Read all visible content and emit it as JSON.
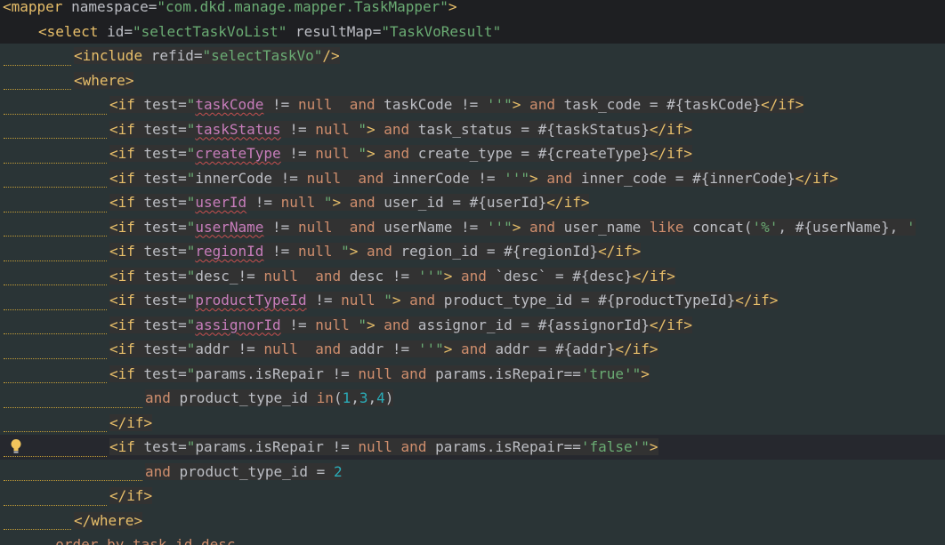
{
  "lines": [
    {
      "indent": 0,
      "type": "xml",
      "tokens": [
        {
          "t": "<",
          "c": "ang"
        },
        {
          "t": "mapper",
          "c": "tag"
        },
        {
          "t": " namespace=",
          "c": "attr"
        },
        {
          "t": "\"com.dkd.manage.mapper.TaskMapper\"",
          "c": "val"
        },
        {
          "t": ">",
          "c": "ang"
        }
      ]
    },
    {
      "indent": 1,
      "type": "xml",
      "tokens": [
        {
          "t": "<",
          "c": "ang"
        },
        {
          "t": "select",
          "c": "tag"
        },
        {
          "t": " id=",
          "c": "attr"
        },
        {
          "t": "\"selectTaskVoList\"",
          "c": "val"
        },
        {
          "t": " resultMap=",
          "c": "attr"
        },
        {
          "t": "\"",
          "c": "val"
        },
        {
          "t": "TaskVoResult",
          "c": "val"
        },
        {
          "t": "\"",
          "c": "val"
        }
      ]
    },
    {
      "indent": 2,
      "type": "sql",
      "tokens": [
        {
          "t": "<",
          "c": "ang"
        },
        {
          "t": "include",
          "c": "tag"
        },
        {
          "t": " refid=",
          "c": "attr"
        },
        {
          "t": "\"selectTaskVo\"",
          "c": "val"
        },
        {
          "t": "/>",
          "c": "ang"
        }
      ]
    },
    {
      "indent": 2,
      "type": "sql",
      "tokens": [
        {
          "t": "<",
          "c": "ang"
        },
        {
          "t": "where",
          "c": "tag"
        },
        {
          "t": ">",
          "c": "ang"
        }
      ]
    },
    {
      "indent": 3,
      "type": "sql",
      "tokens": [
        {
          "t": "<",
          "c": "ang"
        },
        {
          "t": "if",
          "c": "tag"
        },
        {
          "t": " test=",
          "c": "attr"
        },
        {
          "t": "\"",
          "c": "val"
        },
        {
          "t": "taskCode",
          "c": "ident"
        },
        {
          "t": " != ",
          "c": "plain"
        },
        {
          "t": "null",
          "c": "kw"
        },
        {
          "t": "  ",
          "c": "plain"
        },
        {
          "t": "and",
          "c": "kw"
        },
        {
          "t": " taskCode != ",
          "c": "plain"
        },
        {
          "t": "''\"",
          "c": "val"
        },
        {
          "t": ">",
          "c": "ang"
        },
        {
          "t": " and",
          "c": "kw"
        },
        {
          "t": " task_code = #{taskCode}",
          "c": "plain"
        },
        {
          "t": "</",
          "c": "ang"
        },
        {
          "t": "if",
          "c": "tag"
        },
        {
          "t": ">",
          "c": "ang"
        }
      ]
    },
    {
      "indent": 3,
      "type": "sql",
      "tokens": [
        {
          "t": "<",
          "c": "ang"
        },
        {
          "t": "if",
          "c": "tag"
        },
        {
          "t": " test=",
          "c": "attr"
        },
        {
          "t": "\"",
          "c": "val"
        },
        {
          "t": "taskStatus",
          "c": "ident"
        },
        {
          "t": " != ",
          "c": "plain"
        },
        {
          "t": "null",
          "c": "kw"
        },
        {
          "t": " \"",
          "c": "val"
        },
        {
          "t": ">",
          "c": "ang"
        },
        {
          "t": " and",
          "c": "kw"
        },
        {
          "t": " task_status = #{taskStatus}",
          "c": "plain"
        },
        {
          "t": "</",
          "c": "ang"
        },
        {
          "t": "if",
          "c": "tag"
        },
        {
          "t": ">",
          "c": "ang"
        }
      ]
    },
    {
      "indent": 3,
      "type": "sql",
      "tokens": [
        {
          "t": "<",
          "c": "ang"
        },
        {
          "t": "if",
          "c": "tag"
        },
        {
          "t": " test=",
          "c": "attr"
        },
        {
          "t": "\"",
          "c": "val"
        },
        {
          "t": "createType",
          "c": "ident"
        },
        {
          "t": " != ",
          "c": "plain"
        },
        {
          "t": "null",
          "c": "kw"
        },
        {
          "t": " \"",
          "c": "val"
        },
        {
          "t": ">",
          "c": "ang"
        },
        {
          "t": " and",
          "c": "kw"
        },
        {
          "t": " create_type = #{createType}",
          "c": "plain"
        },
        {
          "t": "</",
          "c": "ang"
        },
        {
          "t": "if",
          "c": "tag"
        },
        {
          "t": ">",
          "c": "ang"
        }
      ]
    },
    {
      "indent": 3,
      "type": "sql",
      "tokens": [
        {
          "t": "<",
          "c": "ang"
        },
        {
          "t": "if",
          "c": "tag"
        },
        {
          "t": " test=",
          "c": "attr"
        },
        {
          "t": "\"",
          "c": "val"
        },
        {
          "t": "innerCode != ",
          "c": "plain"
        },
        {
          "t": "null",
          "c": "kw"
        },
        {
          "t": "  ",
          "c": "plain"
        },
        {
          "t": "and",
          "c": "kw"
        },
        {
          "t": " innerCode != ",
          "c": "plain"
        },
        {
          "t": "''\"",
          "c": "val"
        },
        {
          "t": ">",
          "c": "ang"
        },
        {
          "t": " and",
          "c": "kw"
        },
        {
          "t": " inner_code = #{innerCode}",
          "c": "plain"
        },
        {
          "t": "</",
          "c": "ang"
        },
        {
          "t": "if",
          "c": "tag"
        },
        {
          "t": ">",
          "c": "ang"
        }
      ]
    },
    {
      "indent": 3,
      "type": "sql",
      "tokens": [
        {
          "t": "<",
          "c": "ang"
        },
        {
          "t": "if",
          "c": "tag"
        },
        {
          "t": " test=",
          "c": "attr"
        },
        {
          "t": "\"",
          "c": "val"
        },
        {
          "t": "userId",
          "c": "ident"
        },
        {
          "t": " != ",
          "c": "plain"
        },
        {
          "t": "null",
          "c": "kw"
        },
        {
          "t": " \"",
          "c": "val"
        },
        {
          "t": ">",
          "c": "ang"
        },
        {
          "t": " and",
          "c": "kw"
        },
        {
          "t": " user_id = #{userId}",
          "c": "plain"
        },
        {
          "t": "</",
          "c": "ang"
        },
        {
          "t": "if",
          "c": "tag"
        },
        {
          "t": ">",
          "c": "ang"
        }
      ]
    },
    {
      "indent": 3,
      "type": "sql",
      "tokens": [
        {
          "t": "<",
          "c": "ang"
        },
        {
          "t": "if",
          "c": "tag"
        },
        {
          "t": " test=",
          "c": "attr"
        },
        {
          "t": "\"",
          "c": "val"
        },
        {
          "t": "userName",
          "c": "ident"
        },
        {
          "t": " != ",
          "c": "plain"
        },
        {
          "t": "null",
          "c": "kw"
        },
        {
          "t": "  ",
          "c": "plain"
        },
        {
          "t": "and",
          "c": "kw"
        },
        {
          "t": " userName != ",
          "c": "plain"
        },
        {
          "t": "''\"",
          "c": "val"
        },
        {
          "t": ">",
          "c": "ang"
        },
        {
          "t": " and",
          "c": "kw"
        },
        {
          "t": " user_name ",
          "c": "plain"
        },
        {
          "t": "like",
          "c": "kw"
        },
        {
          "t": " concat(",
          "c": "plain"
        },
        {
          "t": "'%'",
          "c": "str"
        },
        {
          "t": ", #{userName}, ",
          "c": "plain"
        },
        {
          "t": "'",
          "c": "str"
        }
      ]
    },
    {
      "indent": 3,
      "type": "sql",
      "tokens": [
        {
          "t": "<",
          "c": "ang"
        },
        {
          "t": "if",
          "c": "tag"
        },
        {
          "t": " test=",
          "c": "attr"
        },
        {
          "t": "\"",
          "c": "val"
        },
        {
          "t": "regionId",
          "c": "ident"
        },
        {
          "t": " != ",
          "c": "plain"
        },
        {
          "t": "null",
          "c": "kw"
        },
        {
          "t": " \"",
          "c": "val"
        },
        {
          "t": ">",
          "c": "ang"
        },
        {
          "t": " and",
          "c": "kw"
        },
        {
          "t": " region_id = #{regionId}",
          "c": "plain"
        },
        {
          "t": "</",
          "c": "ang"
        },
        {
          "t": "if",
          "c": "tag"
        },
        {
          "t": ">",
          "c": "ang"
        }
      ]
    },
    {
      "indent": 3,
      "type": "sql",
      "tokens": [
        {
          "t": "<",
          "c": "ang"
        },
        {
          "t": "if",
          "c": "tag"
        },
        {
          "t": " test=",
          "c": "attr"
        },
        {
          "t": "\"",
          "c": "val"
        },
        {
          "t": "desc_",
          "c": "plain"
        },
        {
          "t": "!= ",
          "c": "plain"
        },
        {
          "t": "null",
          "c": "kw"
        },
        {
          "t": "  ",
          "c": "plain"
        },
        {
          "t": "and",
          "c": "kw"
        },
        {
          "t": " desc != ",
          "c": "plain"
        },
        {
          "t": "''\"",
          "c": "val"
        },
        {
          "t": ">",
          "c": "ang"
        },
        {
          "t": " and",
          "c": "kw"
        },
        {
          "t": " `desc` = #{desc}",
          "c": "plain"
        },
        {
          "t": "</",
          "c": "ang"
        },
        {
          "t": "if",
          "c": "tag"
        },
        {
          "t": ">",
          "c": "ang"
        }
      ]
    },
    {
      "indent": 3,
      "type": "sql",
      "tokens": [
        {
          "t": "<",
          "c": "ang"
        },
        {
          "t": "if",
          "c": "tag"
        },
        {
          "t": " test=",
          "c": "attr"
        },
        {
          "t": "\"",
          "c": "val"
        },
        {
          "t": "productTypeId",
          "c": "ident"
        },
        {
          "t": " != ",
          "c": "plain"
        },
        {
          "t": "null",
          "c": "kw"
        },
        {
          "t": " \"",
          "c": "val"
        },
        {
          "t": ">",
          "c": "ang"
        },
        {
          "t": " and",
          "c": "kw"
        },
        {
          "t": " product_type_id = #{productTypeId}",
          "c": "plain"
        },
        {
          "t": "</",
          "c": "ang"
        },
        {
          "t": "if",
          "c": "tag"
        },
        {
          "t": ">",
          "c": "ang"
        }
      ]
    },
    {
      "indent": 3,
      "type": "sql",
      "tokens": [
        {
          "t": "<",
          "c": "ang"
        },
        {
          "t": "if",
          "c": "tag"
        },
        {
          "t": " test=",
          "c": "attr"
        },
        {
          "t": "\"",
          "c": "val"
        },
        {
          "t": "assignorId",
          "c": "ident"
        },
        {
          "t": " != ",
          "c": "plain"
        },
        {
          "t": "null",
          "c": "kw"
        },
        {
          "t": " \"",
          "c": "val"
        },
        {
          "t": ">",
          "c": "ang"
        },
        {
          "t": " and",
          "c": "kw"
        },
        {
          "t": " assignor_id = #{assignorId}",
          "c": "plain"
        },
        {
          "t": "</",
          "c": "ang"
        },
        {
          "t": "if",
          "c": "tag"
        },
        {
          "t": ">",
          "c": "ang"
        }
      ]
    },
    {
      "indent": 3,
      "type": "sql",
      "tokens": [
        {
          "t": "<",
          "c": "ang"
        },
        {
          "t": "if",
          "c": "tag"
        },
        {
          "t": " test=",
          "c": "attr"
        },
        {
          "t": "\"",
          "c": "val"
        },
        {
          "t": "addr != ",
          "c": "plain"
        },
        {
          "t": "null",
          "c": "kw"
        },
        {
          "t": "  ",
          "c": "plain"
        },
        {
          "t": "and",
          "c": "kw"
        },
        {
          "t": " addr != ",
          "c": "plain"
        },
        {
          "t": "''\"",
          "c": "val"
        },
        {
          "t": ">",
          "c": "ang"
        },
        {
          "t": " and",
          "c": "kw"
        },
        {
          "t": " addr = #{addr}",
          "c": "plain"
        },
        {
          "t": "</",
          "c": "ang"
        },
        {
          "t": "if",
          "c": "tag"
        },
        {
          "t": ">",
          "c": "ang"
        }
      ]
    },
    {
      "indent": 3,
      "type": "sql",
      "tokens": [
        {
          "t": "<",
          "c": "ang"
        },
        {
          "t": "if",
          "c": "tag"
        },
        {
          "t": " test=",
          "c": "attr"
        },
        {
          "t": "\"",
          "c": "val"
        },
        {
          "t": "params.isRepair != ",
          "c": "plain"
        },
        {
          "t": "null",
          "c": "kw"
        },
        {
          "t": " ",
          "c": "plain"
        },
        {
          "t": "and",
          "c": "kw"
        },
        {
          "t": " params.isRepair==",
          "c": "plain"
        },
        {
          "t": "'true'\"",
          "c": "val"
        },
        {
          "t": ">",
          "c": "ang"
        }
      ]
    },
    {
      "indent": 4,
      "type": "sql",
      "tokens": [
        {
          "t": "and",
          "c": "kw"
        },
        {
          "t": " product_type_id ",
          "c": "plain"
        },
        {
          "t": "in",
          "c": "kw"
        },
        {
          "t": "(",
          "c": "plain"
        },
        {
          "t": "1",
          "c": "num"
        },
        {
          "t": ",",
          "c": "plain"
        },
        {
          "t": "3",
          "c": "num"
        },
        {
          "t": ",",
          "c": "plain"
        },
        {
          "t": "4",
          "c": "num"
        },
        {
          "t": ")",
          "c": "plain"
        }
      ]
    },
    {
      "indent": 3,
      "type": "sql",
      "tokens": [
        {
          "t": "</",
          "c": "ang"
        },
        {
          "t": "if",
          "c": "tag"
        },
        {
          "t": ">",
          "c": "ang"
        }
      ]
    },
    {
      "indent": 3,
      "type": "current",
      "bulb": true,
      "tokens": [
        {
          "t": "<",
          "c": "ang"
        },
        {
          "t": "if",
          "c": "tag"
        },
        {
          "t": " test=",
          "c": "attr"
        },
        {
          "t": "\"",
          "c": "val"
        },
        {
          "t": "params.isRepair != ",
          "c": "plain"
        },
        {
          "t": "null",
          "c": "kw"
        },
        {
          "t": " ",
          "c": "plain"
        },
        {
          "t": "and",
          "c": "kw"
        },
        {
          "t": " params.isRepair==",
          "c": "plain"
        },
        {
          "t": "'false'\"",
          "c": "val"
        },
        {
          "t": ">",
          "c": "ang"
        }
      ]
    },
    {
      "indent": 4,
      "type": "sql",
      "tokens": [
        {
          "t": "and",
          "c": "kw"
        },
        {
          "t": " product_type_id = ",
          "c": "plain"
        },
        {
          "t": "2",
          "c": "num"
        }
      ]
    },
    {
      "indent": 3,
      "type": "sql",
      "tokens": [
        {
          "t": "</",
          "c": "ang"
        },
        {
          "t": "if",
          "c": "tag"
        },
        {
          "t": ">",
          "c": "ang"
        }
      ]
    },
    {
      "indent": 2,
      "type": "sql",
      "tokens": [
        {
          "t": "</",
          "c": "ang"
        },
        {
          "t": "where",
          "c": "tag"
        },
        {
          "t": ">",
          "c": "ang"
        }
      ]
    },
    {
      "indent": 1,
      "type": "sql",
      "tokens": [
        {
          "t": "  order by task_id desc",
          "c": "kw"
        }
      ]
    }
  ],
  "icons": {
    "intention_bulb": "lightbulb-icon"
  },
  "colors": {
    "background": "#1e1f22",
    "sql_injection_bg": "#2a3436",
    "tag": "#e8bf6a",
    "attr_value": "#6aab73",
    "keyword": "#cf8e6d",
    "number": "#2aacb8",
    "identifier": "#c77dbb"
  }
}
